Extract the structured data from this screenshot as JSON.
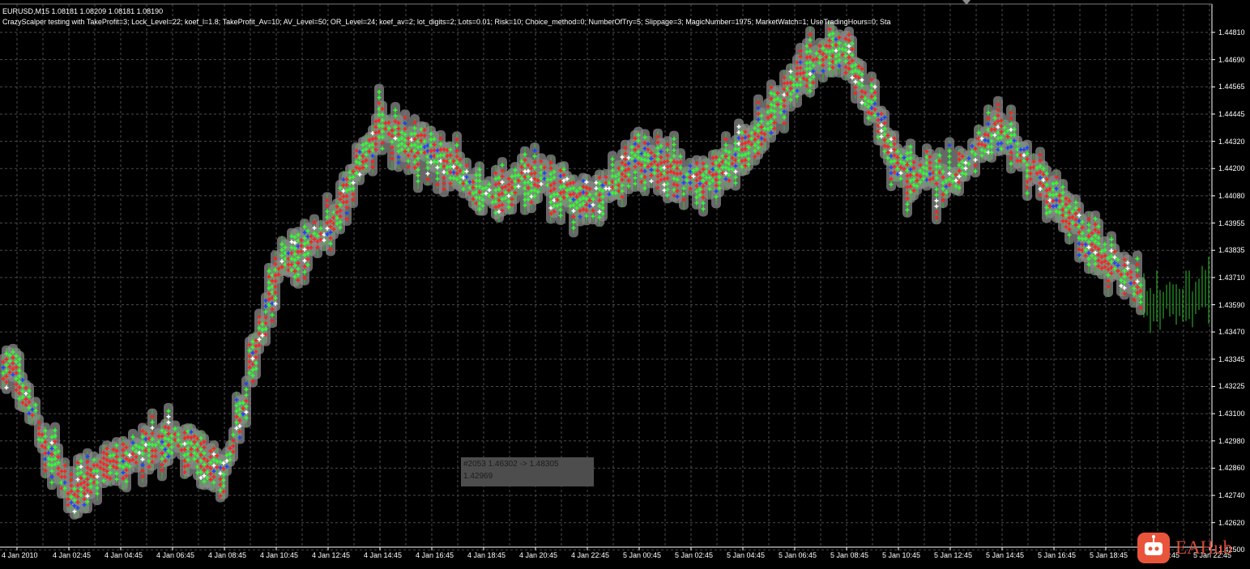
{
  "chart": {
    "symbol_header": "EURUSD,M15  1.08181 1.08209 1.08181 1.08190",
    "ea_params": "CrazyScalper testing with TakeProfit=3; Lock_Level=22; koef_l=1.8; TakeProfit_Av=10; AV_Level=50; OR_Level=24; koef_av=2; lot_digits=2; Lots=0.01; Risk=10; Choice_method=0; NumberOfTry=5; Slippage=3; MagicNumber=1975; MarketWatch=1; UseTradingHours=0; Sta",
    "colors": {
      "background": "#000000",
      "grid": "#4b4b4b",
      "axis": "#ffffff",
      "bar": "#2fbf2f",
      "trade_band": "#8a8a8a",
      "buy_arrow": "#ff2020",
      "sell_arrow": "#2040ff",
      "close_arrow": "#30ff30"
    },
    "tooltip": {
      "line1": "#2053 1.46302 -> 1.48305",
      "line2": "1.42969"
    },
    "watermark": {
      "icon": "robot-icon",
      "text": "EAHub"
    }
  },
  "chart_data": {
    "type": "candlestick",
    "title": "",
    "y_ticks": [
      "1.44810",
      "1.44690",
      "1.44565",
      "1.44445",
      "1.44320",
      "1.44200",
      "1.44080",
      "1.43955",
      "1.43835",
      "1.43710",
      "1.43590",
      "1.43470",
      "1.43345",
      "1.43225",
      "1.43100",
      "1.42980",
      "1.42860",
      "1.42740",
      "1.42620",
      "1.42500"
    ],
    "x_ticks": [
      "4 Jan 2010",
      "4 Jan 02:45",
      "4 Jan 04:45",
      "4 Jan 06:45",
      "4 Jan 08:45",
      "4 Jan 10:45",
      "4 Jan 12:45",
      "4 Jan 14:45",
      "4 Jan 16:45",
      "4 Jan 18:45",
      "4 Jan 20:45",
      "4 Jan 22:45",
      "5 Jan 00:45",
      "5 Jan 02:45",
      "5 Jan 04:45",
      "5 Jan 06:45",
      "5 Jan 08:45",
      "5 Jan 10:45",
      "5 Jan 12:45",
      "5 Jan 14:45",
      "5 Jan 16:45",
      "5 Jan 18:45",
      "5 Jan 20:45",
      "5 Jan 22:45"
    ],
    "ylim": [
      1.425,
      1.4484
    ],
    "price_path": [
      {
        "t": "4 Jan 2010",
        "p": 1.433
      },
      {
        "t": "4 Jan 02:45",
        "p": 1.4275
      },
      {
        "t": "4 Jan 04:45",
        "p": 1.429
      },
      {
        "t": "4 Jan 06:45",
        "p": 1.43
      },
      {
        "t": "4 Jan 08:45",
        "p": 1.4285
      },
      {
        "t": "4 Jan 10:45",
        "p": 1.4375
      },
      {
        "t": "4 Jan 12:45",
        "p": 1.4393
      },
      {
        "t": "4 Jan 14:45",
        "p": 1.444
      },
      {
        "t": "4 Jan 16:45",
        "p": 1.4425
      },
      {
        "t": "4 Jan 18:45",
        "p": 1.441
      },
      {
        "t": "4 Jan 20:45",
        "p": 1.4415
      },
      {
        "t": "4 Jan 22:45",
        "p": 1.4405
      },
      {
        "t": "5 Jan 00:45",
        "p": 1.4425
      },
      {
        "t": "5 Jan 02:45",
        "p": 1.4415
      },
      {
        "t": "5 Jan 04:45",
        "p": 1.4425
      },
      {
        "t": "5 Jan 06:45",
        "p": 1.446
      },
      {
        "t": "5 Jan 08:45",
        "p": 1.4475
      },
      {
        "t": "5 Jan 10:45",
        "p": 1.442
      },
      {
        "t": "5 Jan 12:45",
        "p": 1.4415
      },
      {
        "t": "5 Jan 14:45",
        "p": 1.444
      },
      {
        "t": "5 Jan 16:45",
        "p": 1.4405
      },
      {
        "t": "5 Jan 18:45",
        "p": 1.438
      },
      {
        "t": "5 Jan 20:45",
        "p": 1.436
      },
      {
        "t": "5 Jan 22:45",
        "p": 1.4365
      }
    ],
    "grid": true
  }
}
